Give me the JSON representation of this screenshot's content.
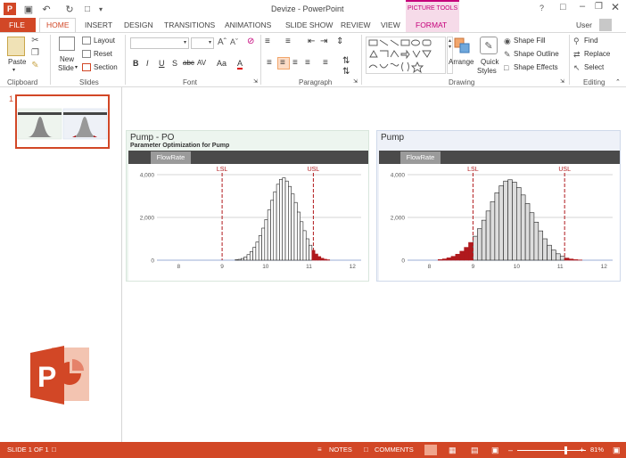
{
  "window": {
    "title": "Devize - PowerPoint",
    "context_tab_group": "PICTURE TOOLS",
    "help": "?",
    "user": "User"
  },
  "tabs": [
    "FILE",
    "HOME",
    "INSERT",
    "DESIGN",
    "TRANSITIONS",
    "ANIMATIONS",
    "SLIDE SHOW",
    "REVIEW",
    "VIEW",
    "FORMAT"
  ],
  "active_tab": "HOME",
  "ribbon": {
    "clipboard": {
      "paste": "Paste",
      "group": "Clipboard"
    },
    "slides": {
      "new_slide_1": "New",
      "new_slide_2": "Slide",
      "layout": "Layout",
      "reset": "Reset",
      "section": "Section",
      "group": "Slides"
    },
    "font": {
      "family": "",
      "size": "",
      "bold": "B",
      "italic": "I",
      "underline": "U",
      "shadow": "S",
      "strike": "abc",
      "spacing": "AV",
      "case": "Aa",
      "color": "A",
      "group": "Font"
    },
    "paragraph": {
      "group": "Paragraph"
    },
    "drawing": {
      "arrange": "Arrange",
      "quick_1": "Quick",
      "quick_2": "Styles",
      "fill": "Shape Fill",
      "outline": "Shape Outline",
      "effects": "Shape Effects",
      "group": "Drawing"
    },
    "editing": {
      "find": "Find",
      "replace": "Replace",
      "select": "Select",
      "group": "Editing"
    }
  },
  "thumbnail": {
    "number": "1"
  },
  "slide": {
    "panel_left": {
      "title": "Pump - PO",
      "subtitle": "Parameter Optimization for Pump",
      "tab": "FlowRate",
      "lsl": "LSL",
      "usl": "USL"
    },
    "panel_right": {
      "title": "Pump",
      "tab": "FlowRate",
      "lsl": "LSL",
      "usl": "USL"
    }
  },
  "chart_data": [
    {
      "type": "bar",
      "title": "Pump - PO",
      "subtitle": "Parameter Optimization for Pump",
      "xlim": [
        7.5,
        12.2
      ],
      "ylim": [
        0,
        4000
      ],
      "xticks": [
        8,
        9,
        10,
        11,
        12
      ],
      "yticks": [
        "0",
        "2,000",
        "4,000"
      ],
      "lsl": 9,
      "usl": 11.1,
      "bin_start": 9.3,
      "bin_width": 0.068,
      "values": [
        20,
        40,
        80,
        150,
        260,
        400,
        600,
        850,
        1150,
        1500,
        1900,
        2350,
        2800,
        3200,
        3550,
        3780,
        3850,
        3700,
        3450,
        3100,
        2700,
        2250,
        1800,
        1380,
        1000,
        700,
        460,
        290,
        170,
        90,
        45,
        20
      ],
      "out_of_spec_color": "#b0191d",
      "in_spec_color": "#ffffff"
    },
    {
      "type": "bar",
      "title": "Pump",
      "xlim": [
        7.5,
        12.2
      ],
      "ylim": [
        0,
        4000
      ],
      "xticks": [
        8,
        9,
        10,
        11,
        12
      ],
      "yticks": [
        "0",
        "2,000",
        "4,000"
      ],
      "lsl": 9,
      "usl": 11.1,
      "bin_start": 8.2,
      "bin_width": 0.1,
      "values": [
        30,
        60,
        110,
        180,
        280,
        420,
        600,
        830,
        1120,
        1470,
        1870,
        2300,
        2740,
        3150,
        3480,
        3700,
        3760,
        3650,
        3400,
        3050,
        2650,
        2220,
        1780,
        1370,
        1000,
        700,
        470,
        300,
        180,
        100,
        55,
        25,
        10
      ],
      "out_of_spec_color": "#b0191d",
      "in_spec_color": "#dddddd"
    }
  ],
  "status": {
    "slide": "SLIDE 1 OF 1",
    "notes": "NOTES",
    "comments": "COMMENTS",
    "zoom": "81%"
  },
  "colors": {
    "accent": "#d24726",
    "context": "#c5007a"
  }
}
